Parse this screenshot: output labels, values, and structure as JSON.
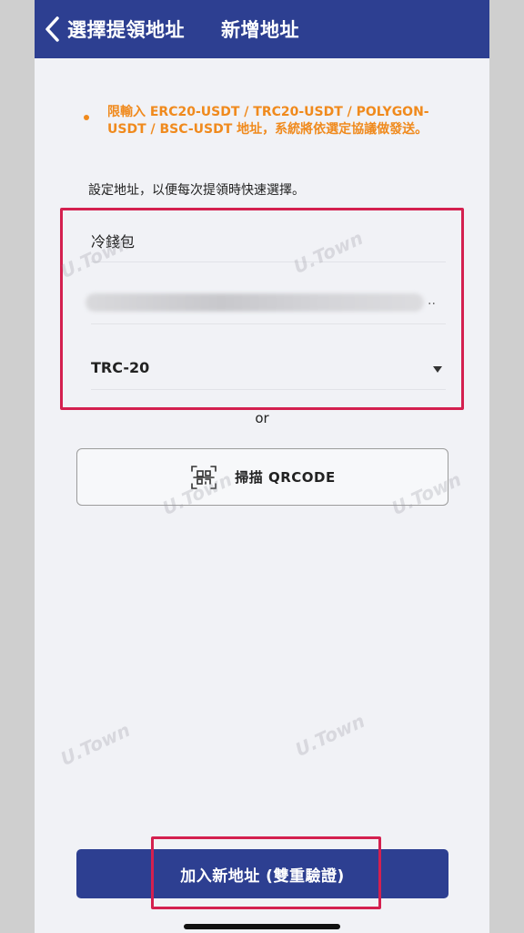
{
  "header": {
    "back_label": "選擇提領地址",
    "title": "新增地址"
  },
  "notice": {
    "text": "限輸入 ERC20-USDT / TRC20-USDT / POLYGON-USDT / BSC-USDT 地址，系統將依選定協議做發送。",
    "color": "#f08a1d"
  },
  "description": "設定地址，以便每次提領時快速選擇。",
  "form": {
    "name_value": "冷錢包",
    "address_suffix": "..",
    "network_value": "TRC-20"
  },
  "or_label": "or",
  "scan_button": {
    "label": "掃描 QRCODE",
    "icon": "qrcode-scan-icon"
  },
  "submit_button": {
    "label": "加入新地址 (雙重驗證)"
  },
  "watermark": "U.Town",
  "colors": {
    "brand": "#2d3f91",
    "highlight": "#d4204f",
    "warning": "#f08a1d"
  }
}
